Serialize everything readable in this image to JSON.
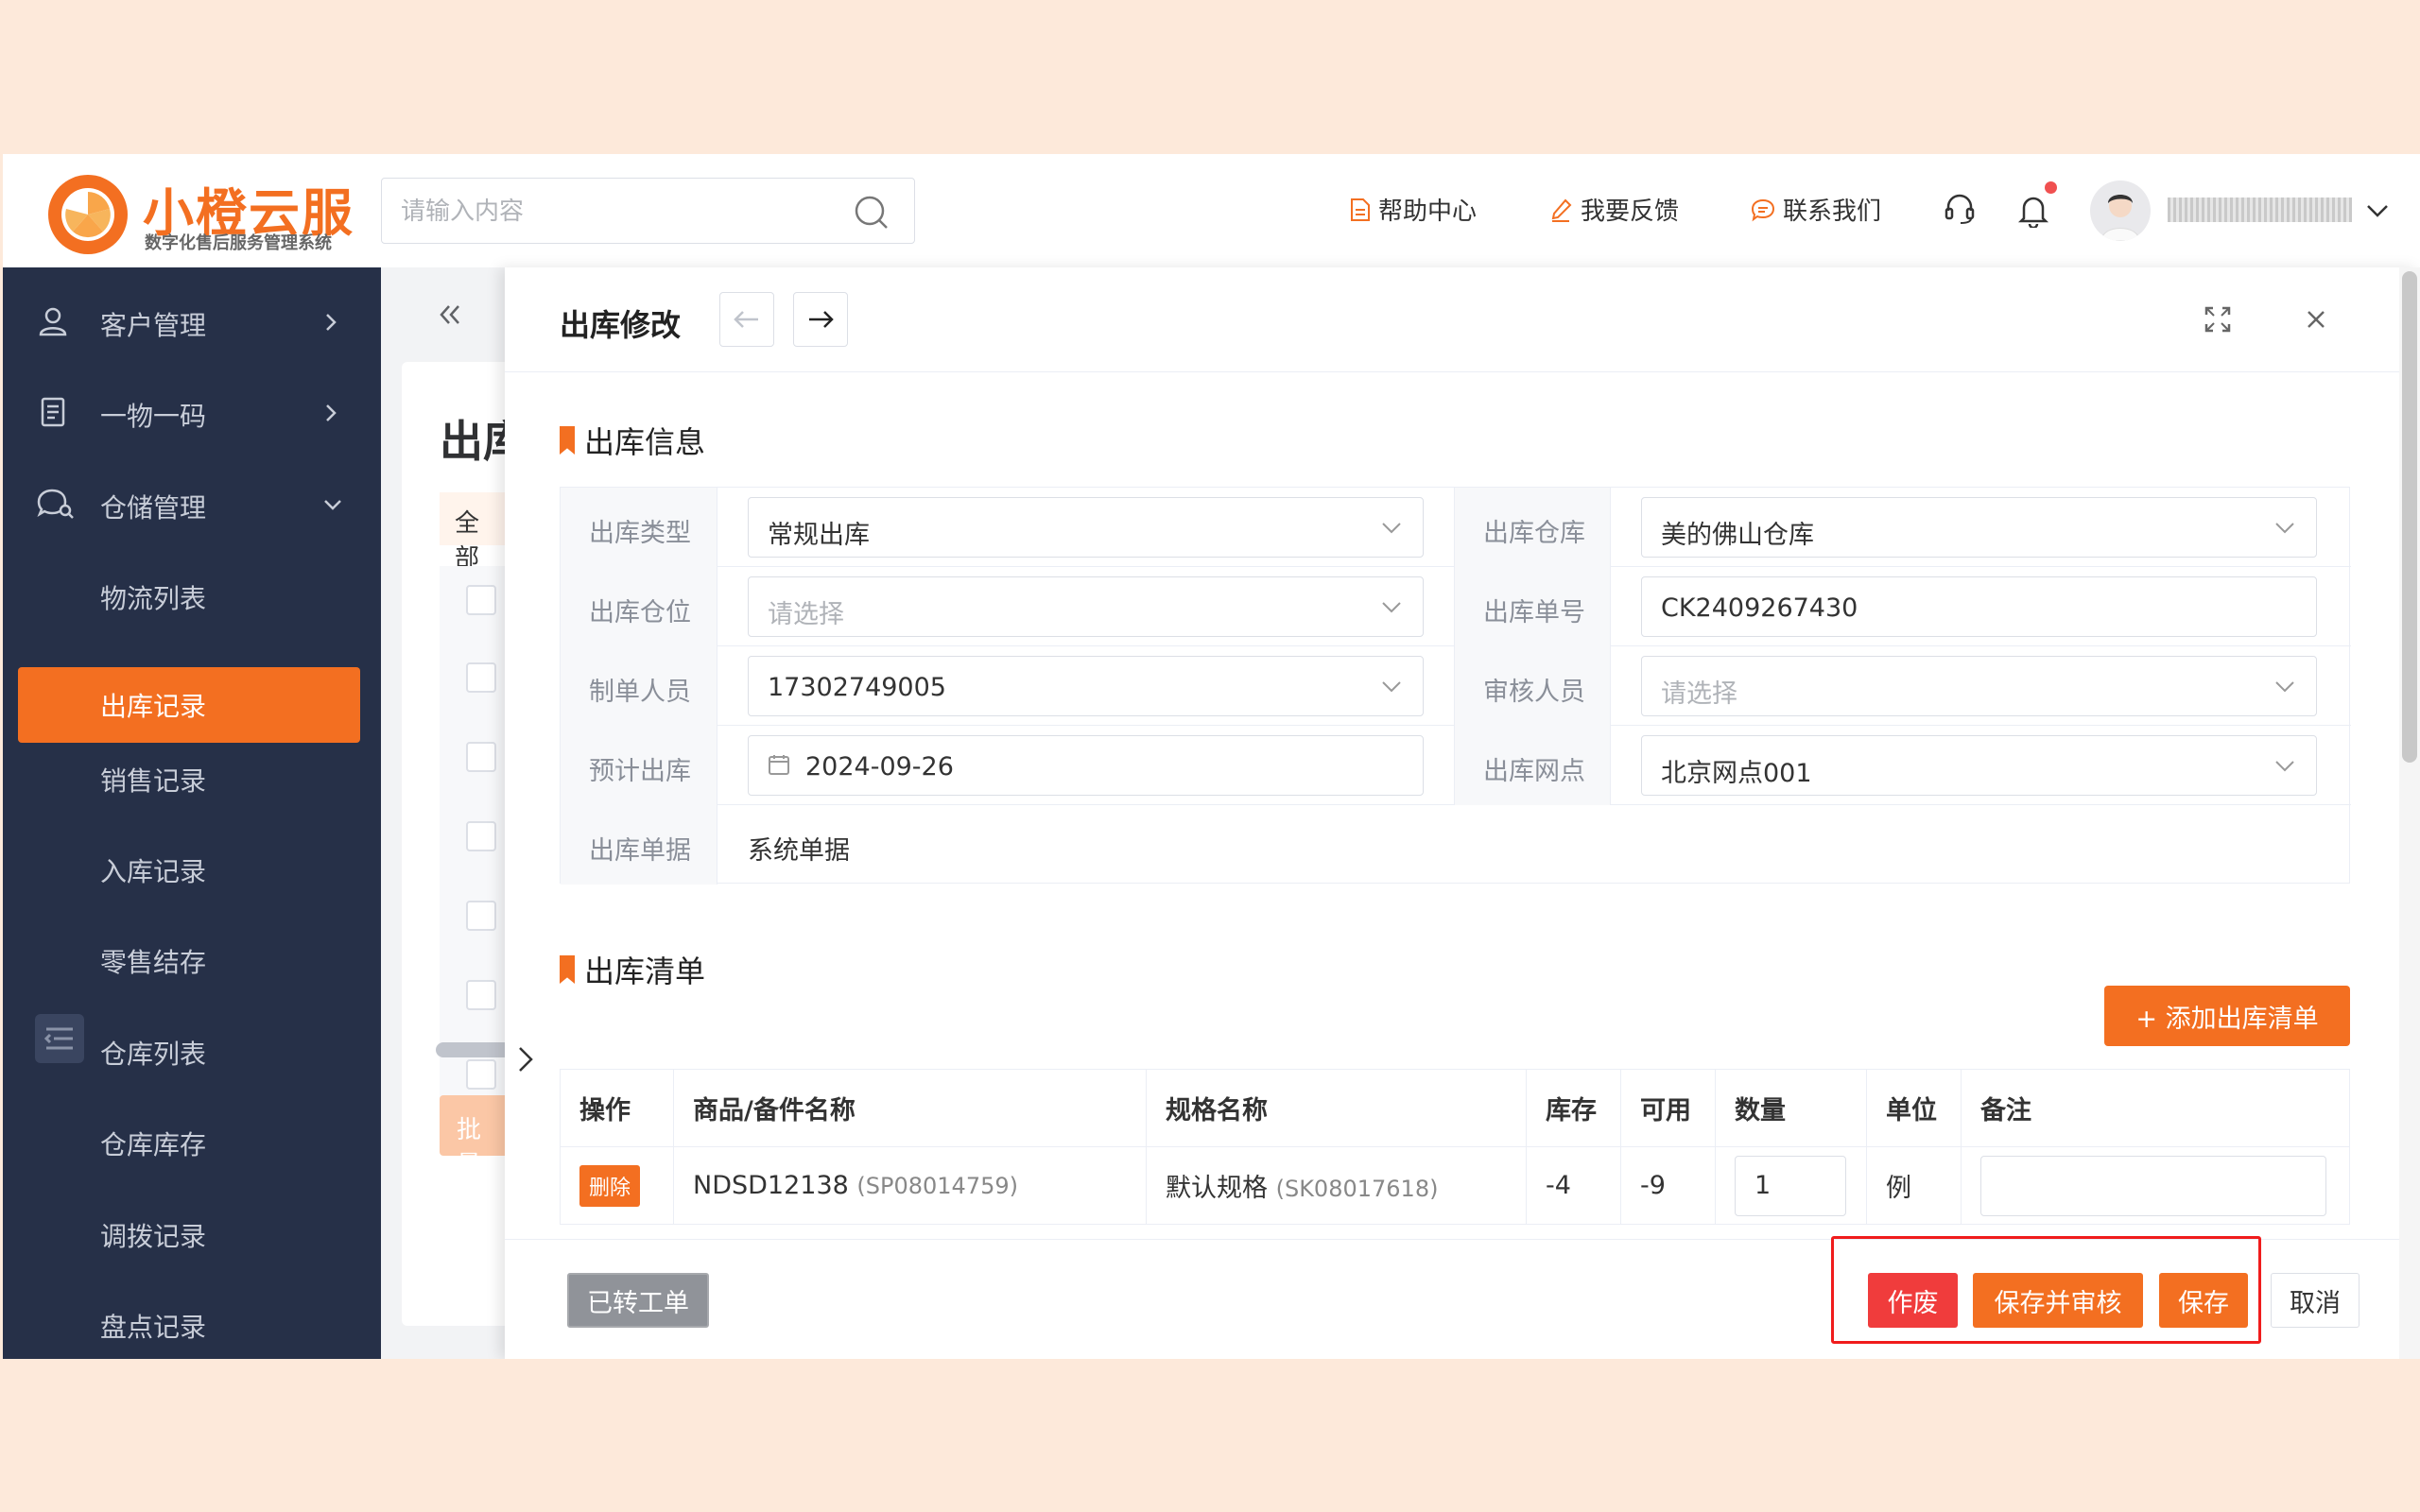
{
  "brand": {
    "name": "小橙云服",
    "subtitle": "数字化售后服务管理系统",
    "accent_color": "#f36f21"
  },
  "header": {
    "search_placeholder": "请输入内容",
    "help_label": "帮助中心",
    "feedback_label": "我要反馈",
    "contact_label": "联系我们"
  },
  "sidebar": {
    "items": [
      {
        "label": "客户管理",
        "icon": "user-icon"
      },
      {
        "label": "一物一码",
        "icon": "document-icon"
      },
      {
        "label": "仓储管理",
        "icon": "chat-search-icon"
      },
      {
        "label": "物流列表"
      },
      {
        "label": "出库记录"
      },
      {
        "label": "销售记录"
      },
      {
        "label": "入库记录"
      },
      {
        "label": "零售结存"
      },
      {
        "label": "仓库列表"
      },
      {
        "label": "仓库库存"
      },
      {
        "label": "调拨记录"
      },
      {
        "label": "盘点记录"
      }
    ],
    "active": "出库记录"
  },
  "background_page": {
    "title": "出库",
    "tab": "全部",
    "batch_button": "批量"
  },
  "drawer": {
    "title": "出库修改",
    "info_section": {
      "title": "出库信息",
      "fields": {
        "type_label": "出库类型",
        "type_value": "常规出库",
        "warehouse_label": "出库仓库",
        "warehouse_value": "美的佛山仓库",
        "location_label": "出库仓位",
        "location_placeholder": "请选择",
        "order_no_label": "出库单号",
        "order_no_value": "CK2409267430",
        "creator_label": "制单人员",
        "creator_value": "17302749005",
        "reviewer_label": "审核人员",
        "reviewer_placeholder": "请选择",
        "expected_label": "预计出库",
        "expected_value": "2024-09-26",
        "outlet_label": "出库网点",
        "outlet_value": "北京网点001",
        "doc_label": "出库单据",
        "doc_value": "系统单据"
      }
    },
    "list_section": {
      "title": "出库清单",
      "add_button": "+ 添加出库清单",
      "columns": [
        "操作",
        "商品/备件名称",
        "规格名称",
        "库存",
        "可用",
        "数量",
        "单位",
        "备注"
      ],
      "rows": [
        {
          "action": "删除",
          "name": "NDSD12138",
          "name_code": "(SP08014759)",
          "spec": "默认规格",
          "spec_code": "(SK08017618)",
          "stock": "-4",
          "available": "-9",
          "quantity": "1",
          "unit": "例",
          "note": ""
        }
      ]
    },
    "footer": {
      "converted_label": "已转工单",
      "void_label": "作废",
      "save_audit_label": "保存并审核",
      "save_label": "保存",
      "cancel_label": "取消"
    }
  }
}
